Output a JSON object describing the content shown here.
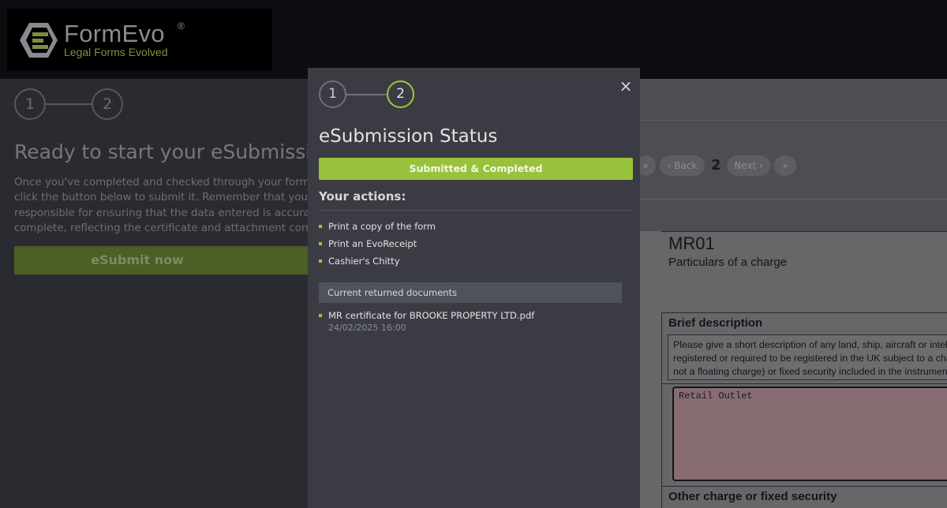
{
  "brand": {
    "name": "FormEvo",
    "registered": "®",
    "tagline": "Legal Forms Evolved",
    "accent": "#98c23c"
  },
  "background_page": {
    "steps": [
      "1",
      "2"
    ],
    "title": "Ready to start your eSubmission",
    "description": "Once you've completed and checked through your form, simply click the button below to submit it. Remember that you are responsible for ensuring that the data entered is accurate and complete, reflecting the certificate and attachment correctly",
    "esubmit_label": "eSubmit now"
  },
  "document": {
    "pager": {
      "first": "«",
      "back": "‹ Back",
      "page": "2",
      "next": "Next ›",
      "last": "»"
    },
    "code": "MR01",
    "name": "Particulars of a charge",
    "brief_heading": "Brief description",
    "instruction": [
      "Please give a short description of any land, ship, aircraft or intellectual property",
      "registered or required to be registered in the UK subject to a charge (which is",
      "not a floating charge) or fixed security included in the instrument."
    ],
    "input_value": "Retail Outlet",
    "other_heading": "Other charge or fixed security"
  },
  "modal": {
    "steps": [
      "1",
      "2"
    ],
    "active_step": 2,
    "close_label": "×",
    "title": "eSubmission Status",
    "status": "Submitted & Completed",
    "actions_heading": "Your actions:",
    "actions": [
      {
        "label": "Print a copy of the form"
      },
      {
        "label": "Print an EvoReceipt"
      },
      {
        "label": "Cashier's Chitty"
      }
    ],
    "returned_docs_heading": "Current returned documents",
    "returned_docs": [
      {
        "name": "MR certificate for BROOKE PROPERTY LTD.pdf",
        "date": "24/02/2025 16:00"
      }
    ]
  }
}
